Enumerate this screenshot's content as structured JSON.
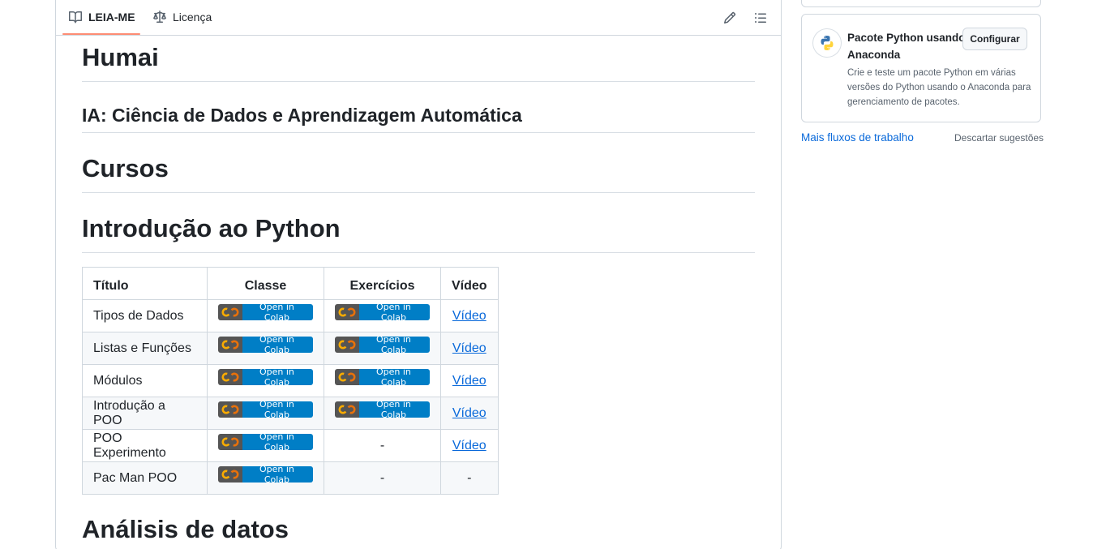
{
  "readme": {
    "tabs": [
      {
        "label": "LEIA-ME",
        "icon": "book-icon"
      },
      {
        "label": "Licença",
        "icon": "law-scale-icon"
      }
    ],
    "tools": [
      "pencil-icon",
      "list-unordered-icon"
    ],
    "accent_color": "#fd8c73"
  },
  "article": {
    "h1_main": "Humai",
    "h2_subtitle": "IA: Ciência de Dados e Aprendizagem Automática",
    "h1_courses": "Cursos",
    "h1_python": "Introdução ao Python",
    "h1_analysis": "Análisis de datos"
  },
  "table": {
    "headers": [
      "Título",
      "Classe",
      "Exercícios",
      "Vídeo"
    ],
    "badge_text": "Open in Colab",
    "rows": [
      {
        "title": "Tipos de Dados",
        "class": "badge",
        "exercises": "badge",
        "video": "Vídeo"
      },
      {
        "title": "Listas e Funções",
        "class": "badge",
        "exercises": "badge",
        "video": "Vídeo"
      },
      {
        "title": "Módulos",
        "class": "badge",
        "exercises": "badge",
        "video": "Vídeo"
      },
      {
        "title": "Introdução a POO",
        "class": "badge",
        "exercises": "badge",
        "video": "Vídeo"
      },
      {
        "title": "POO Experimento",
        "class": "badge",
        "exercises": "-",
        "video": "Vídeo"
      },
      {
        "title": "Pac Man POO",
        "class": "badge",
        "exercises": "-",
        "video": "-"
      }
    ]
  },
  "sidebar": {
    "card_title": "Pacote Python usando Anaconda",
    "configure_label": "Configurar",
    "card_description": "Crie e teste um pacote Python em várias versões do Python usando o Anaconda para gerenciamento de pacotes.",
    "more_workflows": "Mais fluxos de trabalho",
    "dismiss": "Descartar sugestões",
    "icon": "python-logo-icon"
  }
}
